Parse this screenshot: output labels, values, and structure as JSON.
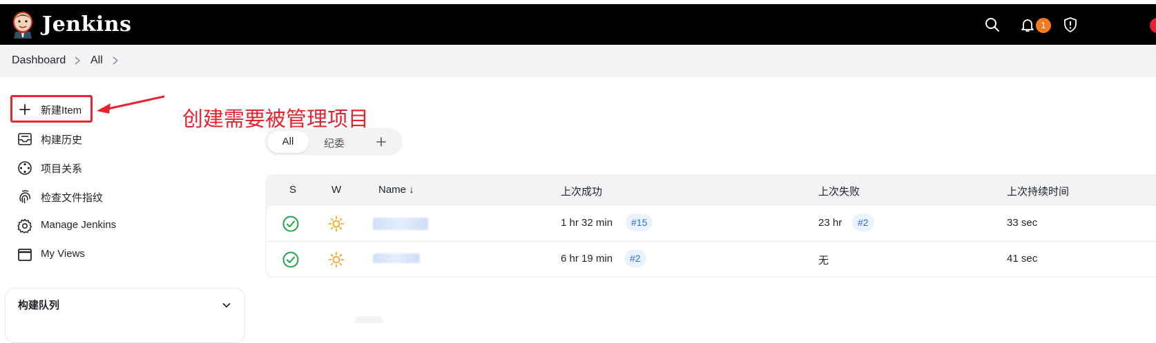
{
  "header": {
    "brand": "Jenkins",
    "notification_count": "1",
    "icons": [
      "jenkins-logo-icon",
      "search-icon",
      "bell-icon",
      "shield-icon"
    ]
  },
  "breadcrumb": {
    "items": [
      "Dashboard",
      "All"
    ]
  },
  "sidebar": {
    "tasks": [
      {
        "label": "新建Item",
        "icon": "plus-icon"
      },
      {
        "label": "构建历史",
        "icon": "inbox-icon"
      },
      {
        "label": "项目关系",
        "icon": "relationship-icon"
      },
      {
        "label": "检查文件指纹",
        "icon": "fingerprint-icon"
      },
      {
        "label": "Manage Jenkins",
        "icon": "gear-icon"
      },
      {
        "label": "My Views",
        "icon": "window-icon"
      }
    ],
    "build_queue_label": "构建队列"
  },
  "annotation": {
    "text": "创建需要被管理项目",
    "color": "#e8222e"
  },
  "view_tabs": {
    "tabs": [
      "All",
      "纪委"
    ],
    "active": "All"
  },
  "table": {
    "columns": [
      "S",
      "W",
      "Name ↓",
      "上次成功",
      "上次失败",
      "上次持续时间"
    ],
    "rows": [
      {
        "status": "success",
        "weather": "sunny",
        "last_success": "1 hr 32 min",
        "last_success_build": "#15",
        "last_failure": "23 hr",
        "last_failure_build": "#2",
        "last_duration": "33 sec"
      },
      {
        "status": "success",
        "weather": "sunny",
        "last_success": "6 hr 19 min",
        "last_success_build": "#2",
        "last_failure": "无",
        "last_failure_build": "",
        "last_duration": "41 sec"
      }
    ]
  },
  "colors": {
    "header_bg": "#000000",
    "success": "#1ea446",
    "weather": "#f5a623",
    "link": "#2a6fdb",
    "badge": "#f47a20"
  }
}
